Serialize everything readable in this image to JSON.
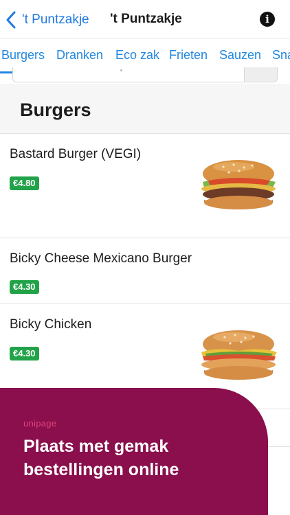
{
  "nav": {
    "back_label": "'t Puntzakje",
    "title": "'t Puntzakje",
    "info_glyph": "i"
  },
  "tabs": [
    {
      "label": "Burgers",
      "active": true
    },
    {
      "label": "Dranken",
      "active": false
    },
    {
      "label": "Eco zak",
      "active": false
    },
    {
      "label": "Frieten",
      "active": false
    },
    {
      "label": "Sauzen",
      "active": false
    },
    {
      "label": "Snacks",
      "active": false
    }
  ],
  "section": {
    "title": "Burgers"
  },
  "items": [
    {
      "name": "Bastard Burger (VEGI)",
      "price": "€4.80",
      "image": "burger-beef-icon"
    },
    {
      "name": "Bicky Cheese Mexicano Burger",
      "price": "€4.30"
    },
    {
      "name": "Bicky Chicken",
      "price": "€4.30",
      "image": "burger-chicken-icon"
    }
  ],
  "promo": {
    "logo": "unipage",
    "text": "Plaats met gemak bestellingen online"
  },
  "colors": {
    "accent": "#1f86e0",
    "price_badge": "#22a34a",
    "promo_bg": "#8a0f4c",
    "promo_logo": "#e0457c"
  }
}
